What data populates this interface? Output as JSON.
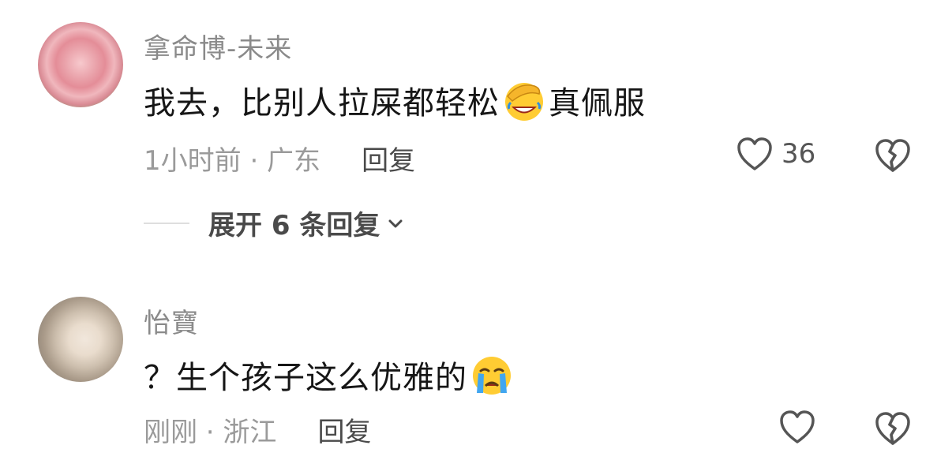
{
  "comments": [
    {
      "username": "拿命博-未来",
      "text_before": "我去，比别人拉屎都轻松",
      "emoji": "facepalm-laughing-emoji",
      "text_after": "真佩服",
      "time_location": "1小时前 · 广东",
      "reply_label": "回复",
      "like_count": "36",
      "expand_label": "展开 6 条回复"
    },
    {
      "username": "怡寶",
      "text_before": "？生个孩子这么优雅的",
      "emoji": "crying-emoji",
      "text_after": "",
      "time_location": "刚刚 · 浙江",
      "reply_label": "回复"
    }
  ],
  "colors": {
    "username": "#8a8a8a",
    "meta": "#9a9a9a",
    "text": "#161616",
    "icon": "#555555"
  }
}
